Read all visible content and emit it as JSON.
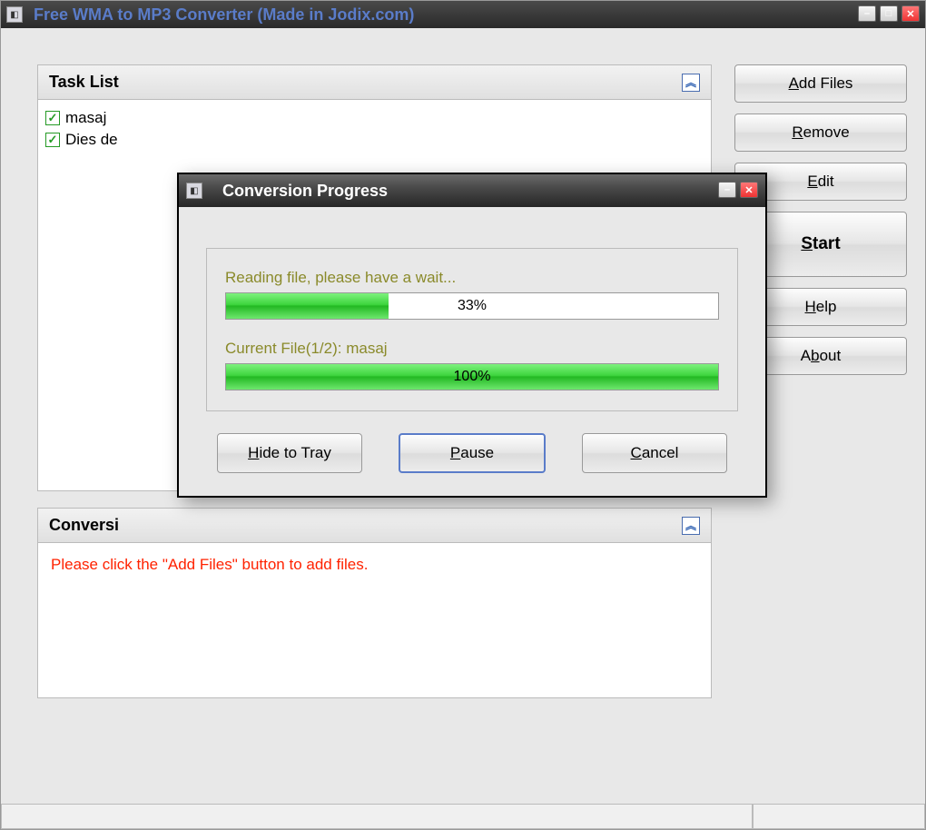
{
  "main": {
    "title": "Free WMA to MP3 Converter   (Made in Jodix.com)"
  },
  "task_list": {
    "title": "Task List",
    "items": [
      {
        "label": "masaj",
        "checked": true
      },
      {
        "label": "Dies de",
        "checked": true
      }
    ]
  },
  "buttons": {
    "add_files": "Add Files",
    "remove": "Remove",
    "edit": "Edit",
    "start": "Start",
    "help": "Help",
    "about": "About"
  },
  "conversion_panel": {
    "title": "Conversi",
    "message": "Please click the \"Add Files\" button to add files."
  },
  "dialog": {
    "title": "Conversion Progress",
    "reading_label": "Reading file, please have a wait...",
    "reading_percent": "33%",
    "reading_fill": 33,
    "current_label": "Current File(1/2): masaj",
    "current_percent": "100%",
    "current_fill": 100,
    "hide": "Hide to Tray",
    "pause": "Pause",
    "cancel": "Cancel"
  }
}
